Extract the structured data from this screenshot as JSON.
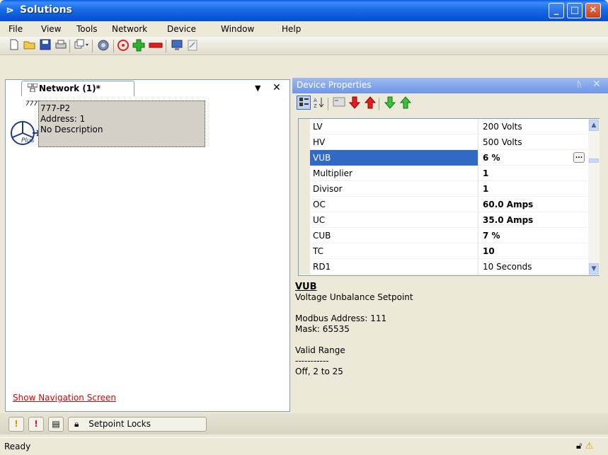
{
  "app": {
    "title": "Solutions",
    "title_glyph": "⋗"
  },
  "titlebar_buttons": {
    "minimize": "_",
    "maximize": "□",
    "close": "✕"
  },
  "menu": [
    "File",
    "View",
    "Tools",
    "Network",
    "Device",
    "Window",
    "Help"
  ],
  "toolbar": {
    "icons": [
      "new-icon",
      "open-folder-icon",
      "save-icon",
      "print-icon",
      "window-cascade-icon",
      "connect-icon",
      "scan-icon",
      "add-icon",
      "remove-icon",
      "monitor-icon",
      "edit-icon"
    ]
  },
  "network_tab": {
    "label": "Network (1)*",
    "icon": "network-icon"
  },
  "device": {
    "number": "777",
    "plus": "Plus",
    "name": "777-P2",
    "address": "Address: 1",
    "description": "No Description"
  },
  "show_nav_link": "Show Navigation Screen",
  "props": {
    "title": "Device Properties",
    "pin": "ᚢ",
    "rows": [
      {
        "name": "LV",
        "value": "200 Volts",
        "bold": false
      },
      {
        "name": "HV",
        "value": "500 Volts",
        "bold": false
      },
      {
        "name": "VUB",
        "value": "6 %",
        "bold": true,
        "selected": true
      },
      {
        "name": "Multiplier",
        "value": "1",
        "bold": true
      },
      {
        "name": "Divisor",
        "value": "1",
        "bold": true
      },
      {
        "name": "OC",
        "value": "60.0 Amps",
        "bold": true
      },
      {
        "name": "UC",
        "value": "35.0 Amps",
        "bold": true
      },
      {
        "name": "CUB",
        "value": "7 %",
        "bold": true
      },
      {
        "name": "TC",
        "value": "10",
        "bold": true
      },
      {
        "name": "RD1",
        "value": "10 Seconds",
        "bold": false
      }
    ],
    "ellipsis": "..."
  },
  "description": {
    "title": "VUB",
    "text": "Voltage Unbalance Setpoint",
    "modbus": "Modbus Address: 111",
    "mask": "Mask: 65535",
    "range_label": "Valid Range",
    "dashes": "-----------",
    "range": "Off, 2 to 25"
  },
  "bottom_tabs": {
    "setpoint_locks": "Setpoint Locks"
  },
  "status": {
    "text": "Ready"
  },
  "colors": {
    "selection": "#316ac5",
    "link": "#e00000",
    "title_bar": "#0a5ce6"
  }
}
